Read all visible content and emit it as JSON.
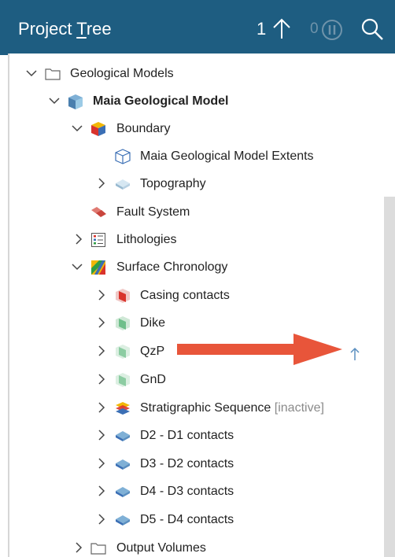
{
  "header": {
    "title_before": "Project ",
    "title_underlined": "T",
    "title_after": "ree",
    "count": "1",
    "pending_count": "0"
  },
  "tree": {
    "geological_models": "Geological Models",
    "maia_model": "Maia Geological Model",
    "boundary": "Boundary",
    "maia_extents": "Maia Geological Model Extents",
    "topography": "Topography",
    "fault_system": "Fault System",
    "lithologies": "Lithologies",
    "surface_chronology": "Surface Chronology",
    "casing_contacts": "Casing contacts",
    "dike": "Dike",
    "qzp": "QzP",
    "gnd": "GnD",
    "stratigraphic_sequence": "Stratigraphic Sequence",
    "inactive_tag": "[inactive]",
    "d2_d1": "D2 - D1 contacts",
    "d3_d2": "D3 - D2 contacts",
    "d4_d3": "D4 - D3 contacts",
    "d5_d4": "D5 - D4 contacts",
    "output_volumes": "Output Volumes"
  },
  "colors": {
    "header_bg": "#1e5d81",
    "annotation_arrow": "#e8553a",
    "status_arrow": "#5a8fc0"
  },
  "icons": [
    "up-arrow-icon",
    "pause-icon",
    "search-icon",
    "folder-icon",
    "geomodel-icon",
    "boundary-icon",
    "extents-box-icon",
    "topography-icon",
    "fault-system-icon",
    "lithologies-icon",
    "chronology-icon",
    "surface-icon",
    "stratigraphy-icon",
    "contact-surface-icon",
    "chevron-right-icon",
    "chevron-down-icon"
  ]
}
